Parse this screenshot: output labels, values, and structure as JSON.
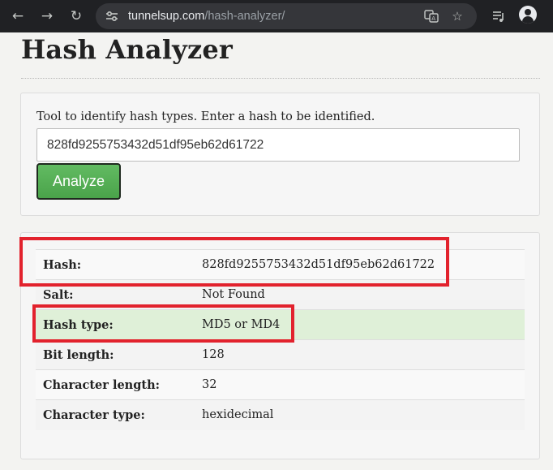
{
  "browser": {
    "url_host": "tunnelsup.com",
    "url_path": "/hash-analyzer/",
    "back_icon": "arrow-left-icon",
    "forward_icon": "arrow-right-icon",
    "reload_icon": "reload-icon",
    "site_info_icon": "tune-icon",
    "translate_icon": "translate-icon",
    "bookmark_icon": "star-icon",
    "media_icon": "media-queue-icon",
    "profile_icon": "avatar-icon"
  },
  "page": {
    "title": "Hash Analyzer"
  },
  "form": {
    "intro": "Tool to identify hash types. Enter a hash to be identified.",
    "hash_value": "828fd9255753432d51df95eb62d61722",
    "analyze_label": "Analyze",
    "accent_color": "#53ad53"
  },
  "results": {
    "rows": [
      {
        "label": "Hash:",
        "value": "828fd9255753432d51df95eb62d61722"
      },
      {
        "label": "Salt:",
        "value": "Not Found"
      },
      {
        "label": "Hash type:",
        "value": "MD5 or MD4"
      },
      {
        "label": "Bit length:",
        "value": "128"
      },
      {
        "label": "Character length:",
        "value": "32"
      },
      {
        "label": "Character type:",
        "value": "hexidecimal"
      }
    ],
    "highlight_color": "#dff0d8",
    "annotation_color": "#e2222d"
  }
}
